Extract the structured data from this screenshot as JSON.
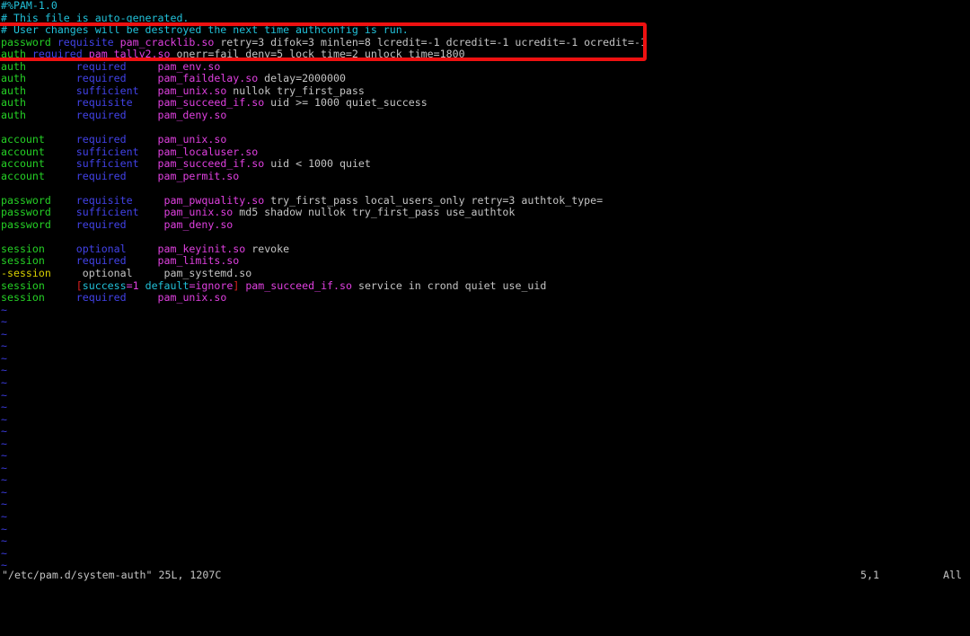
{
  "editor": {
    "name": "vim",
    "file_lines": [
      {
        "id": "line-1",
        "tokens": [
          {
            "text": "#%PAM-1.0",
            "cls": "c-comment"
          }
        ]
      },
      {
        "id": "line-2",
        "tokens": [
          {
            "text": "# This file is auto-generated.",
            "cls": "c-comment"
          }
        ]
      },
      {
        "id": "line-3",
        "tokens": [
          {
            "text": "# User changes will be destroyed the next time authconfig is run.",
            "cls": "c-comment"
          }
        ]
      },
      {
        "id": "line-4",
        "tokens": [
          {
            "text": "password",
            "cls": "c-type"
          },
          {
            "text": " ",
            "cls": "c-plain"
          },
          {
            "text": "requisite",
            "cls": "c-ctrl"
          },
          {
            "text": " ",
            "cls": "c-plain"
          },
          {
            "text": "pam_cracklib.so",
            "cls": "c-module"
          },
          {
            "text": " retry=3 difok=3 minlen=8 lcredit=-1 dcredit=-1 ucredit=-1 ocredit=-1",
            "cls": "c-arg"
          }
        ]
      },
      {
        "id": "line-5",
        "tokens": [
          {
            "text": "auth",
            "cls": "c-type"
          },
          {
            "text": " ",
            "cls": "c-plain"
          },
          {
            "text": "required",
            "cls": "c-ctrl"
          },
          {
            "text": " ",
            "cls": "c-plain"
          },
          {
            "text": "pam_tally2.so",
            "cls": "c-module"
          },
          {
            "text": " onerr=fail deny=5 lock_time=2 unlock_time=1800",
            "cls": "c-arg"
          }
        ]
      },
      {
        "id": "line-6",
        "tokens": [
          {
            "text": "auth",
            "cls": "c-type"
          },
          {
            "text": "        ",
            "cls": "c-plain"
          },
          {
            "text": "required",
            "cls": "c-ctrl"
          },
          {
            "text": "     ",
            "cls": "c-plain"
          },
          {
            "text": "pam_env.so",
            "cls": "c-module"
          }
        ]
      },
      {
        "id": "line-7",
        "tokens": [
          {
            "text": "auth",
            "cls": "c-type"
          },
          {
            "text": "        ",
            "cls": "c-plain"
          },
          {
            "text": "required",
            "cls": "c-ctrl"
          },
          {
            "text": "     ",
            "cls": "c-plain"
          },
          {
            "text": "pam_faildelay.so",
            "cls": "c-module"
          },
          {
            "text": " delay=2000000",
            "cls": "c-arg"
          }
        ]
      },
      {
        "id": "line-8",
        "tokens": [
          {
            "text": "auth",
            "cls": "c-type"
          },
          {
            "text": "        ",
            "cls": "c-plain"
          },
          {
            "text": "sufficient",
            "cls": "c-ctrl"
          },
          {
            "text": "   ",
            "cls": "c-plain"
          },
          {
            "text": "pam_unix.so",
            "cls": "c-module"
          },
          {
            "text": " nullok try_first_pass",
            "cls": "c-arg"
          }
        ]
      },
      {
        "id": "line-9",
        "tokens": [
          {
            "text": "auth",
            "cls": "c-type"
          },
          {
            "text": "        ",
            "cls": "c-plain"
          },
          {
            "text": "requisite",
            "cls": "c-ctrl"
          },
          {
            "text": "    ",
            "cls": "c-plain"
          },
          {
            "text": "pam_succeed_if.so",
            "cls": "c-module"
          },
          {
            "text": " uid >= 1000 quiet_success",
            "cls": "c-arg"
          }
        ]
      },
      {
        "id": "line-10",
        "tokens": [
          {
            "text": "auth",
            "cls": "c-type"
          },
          {
            "text": "        ",
            "cls": "c-plain"
          },
          {
            "text": "required",
            "cls": "c-ctrl"
          },
          {
            "text": "     ",
            "cls": "c-plain"
          },
          {
            "text": "pam_deny.so",
            "cls": "c-module"
          }
        ]
      },
      {
        "id": "line-11",
        "tokens": []
      },
      {
        "id": "line-12",
        "tokens": [
          {
            "text": "account",
            "cls": "c-type"
          },
          {
            "text": "     ",
            "cls": "c-plain"
          },
          {
            "text": "required",
            "cls": "c-ctrl"
          },
          {
            "text": "     ",
            "cls": "c-plain"
          },
          {
            "text": "pam_unix.so",
            "cls": "c-module"
          }
        ]
      },
      {
        "id": "line-13",
        "tokens": [
          {
            "text": "account",
            "cls": "c-type"
          },
          {
            "text": "     ",
            "cls": "c-plain"
          },
          {
            "text": "sufficient",
            "cls": "c-ctrl"
          },
          {
            "text": "   ",
            "cls": "c-plain"
          },
          {
            "text": "pam_localuser.so",
            "cls": "c-module"
          }
        ]
      },
      {
        "id": "line-14",
        "tokens": [
          {
            "text": "account",
            "cls": "c-type"
          },
          {
            "text": "     ",
            "cls": "c-plain"
          },
          {
            "text": "sufficient",
            "cls": "c-ctrl"
          },
          {
            "text": "   ",
            "cls": "c-plain"
          },
          {
            "text": "pam_succeed_if.so",
            "cls": "c-module"
          },
          {
            "text": " uid < 1000 quiet",
            "cls": "c-arg"
          }
        ]
      },
      {
        "id": "line-15",
        "tokens": [
          {
            "text": "account",
            "cls": "c-type"
          },
          {
            "text": "     ",
            "cls": "c-plain"
          },
          {
            "text": "required",
            "cls": "c-ctrl"
          },
          {
            "text": "     ",
            "cls": "c-plain"
          },
          {
            "text": "pam_permit.so",
            "cls": "c-module"
          }
        ]
      },
      {
        "id": "line-16",
        "tokens": []
      },
      {
        "id": "line-17",
        "tokens": [
          {
            "text": "password",
            "cls": "c-type"
          },
          {
            "text": "    ",
            "cls": "c-plain"
          },
          {
            "text": "requisite",
            "cls": "c-ctrl"
          },
          {
            "text": "     ",
            "cls": "c-plain"
          },
          {
            "text": "pam_pwquality.so",
            "cls": "c-module"
          },
          {
            "text": " try_first_pass local_users_only retry=3 authtok_type=",
            "cls": "c-arg"
          }
        ]
      },
      {
        "id": "line-18",
        "tokens": [
          {
            "text": "password",
            "cls": "c-type"
          },
          {
            "text": "    ",
            "cls": "c-plain"
          },
          {
            "text": "sufficient",
            "cls": "c-ctrl"
          },
          {
            "text": "    ",
            "cls": "c-plain"
          },
          {
            "text": "pam_unix.so",
            "cls": "c-module"
          },
          {
            "text": " md5 shadow nullok try_first_pass use_authtok",
            "cls": "c-arg"
          }
        ]
      },
      {
        "id": "line-19",
        "tokens": [
          {
            "text": "password",
            "cls": "c-type"
          },
          {
            "text": "    ",
            "cls": "c-plain"
          },
          {
            "text": "required",
            "cls": "c-ctrl"
          },
          {
            "text": "      ",
            "cls": "c-plain"
          },
          {
            "text": "pam_deny.so",
            "cls": "c-module"
          }
        ]
      },
      {
        "id": "line-20",
        "tokens": []
      },
      {
        "id": "line-21",
        "tokens": [
          {
            "text": "session",
            "cls": "c-type"
          },
          {
            "text": "     ",
            "cls": "c-plain"
          },
          {
            "text": "optional",
            "cls": "c-ctrl"
          },
          {
            "text": "     ",
            "cls": "c-plain"
          },
          {
            "text": "pam_keyinit.so",
            "cls": "c-module"
          },
          {
            "text": " revoke",
            "cls": "c-arg"
          }
        ]
      },
      {
        "id": "line-22",
        "tokens": [
          {
            "text": "session",
            "cls": "c-type"
          },
          {
            "text": "     ",
            "cls": "c-plain"
          },
          {
            "text": "required",
            "cls": "c-ctrl"
          },
          {
            "text": "     ",
            "cls": "c-plain"
          },
          {
            "text": "pam_limits.so",
            "cls": "c-module"
          }
        ]
      },
      {
        "id": "line-23",
        "tokens": [
          {
            "text": "-session",
            "cls": "c-neg"
          },
          {
            "text": "     optional     pam_systemd.so",
            "cls": "c-arg"
          }
        ]
      },
      {
        "id": "line-24",
        "tokens": [
          {
            "text": "session",
            "cls": "c-type"
          },
          {
            "text": "     ",
            "cls": "c-plain"
          },
          {
            "text": "[",
            "cls": "c-bracket"
          },
          {
            "text": "success",
            "cls": "c-key"
          },
          {
            "text": "=1",
            "cls": "c-val"
          },
          {
            "text": " ",
            "cls": "c-plain"
          },
          {
            "text": "default",
            "cls": "c-key"
          },
          {
            "text": "=ignore",
            "cls": "c-val"
          },
          {
            "text": "]",
            "cls": "c-bracket"
          },
          {
            "text": " ",
            "cls": "c-plain"
          },
          {
            "text": "pam_succeed_if.so",
            "cls": "c-module"
          },
          {
            "text": " service in crond quiet use_uid",
            "cls": "c-arg"
          }
        ]
      },
      {
        "id": "line-25",
        "tokens": [
          {
            "text": "session",
            "cls": "c-type"
          },
          {
            "text": "     ",
            "cls": "c-plain"
          },
          {
            "text": "required",
            "cls": "c-ctrl"
          },
          {
            "text": "     ",
            "cls": "c-plain"
          },
          {
            "text": "pam_unix.so",
            "cls": "c-module"
          }
        ]
      }
    ],
    "empty_line_marker": "~",
    "empty_line_count": 22,
    "statusbar": {
      "file": "\"/etc/pam.d/system-auth\" 25L, 1207C",
      "position": "5,1",
      "scroll": "All"
    },
    "annotation": {
      "type": "red-rectangle-highlight",
      "color": "#ee1111",
      "covers_lines": "3-5"
    },
    "colors": {
      "background": "#000000",
      "foreground": "#cccccc",
      "comment": "#22c0d8",
      "service_type": "#25d025",
      "control_flag": "#4242e8",
      "module_path": "#e040e0",
      "argument": "#c4c4c4",
      "tilde": "#3b3bdd",
      "negated_type": "#d8d000",
      "bracket": "#e02020",
      "annotation_box": "#ee1111"
    }
  }
}
